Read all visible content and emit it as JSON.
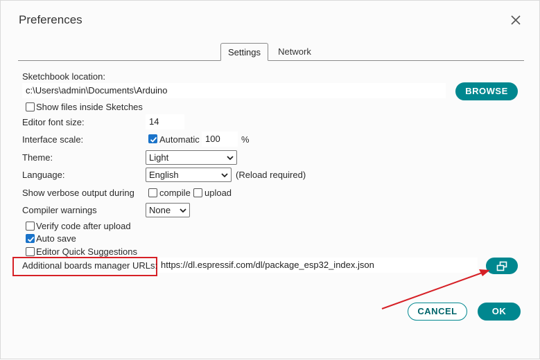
{
  "dialog": {
    "title": "Preferences"
  },
  "tabs": [
    {
      "label": "Settings"
    },
    {
      "label": "Network"
    }
  ],
  "settings": {
    "sketchbook_label": "Sketchbook location:",
    "sketchbook_path": "c:\\Users\\admin\\Documents\\Arduino",
    "browse_label": "BROWSE",
    "show_files_label": "Show files inside Sketches",
    "show_files_checked": false,
    "font_size_label": "Editor font size:",
    "font_size_value": "14",
    "interface_scale_label": "Interface scale:",
    "automatic_label": "Automatic",
    "automatic_checked": true,
    "scale_value": "100",
    "scale_unit": "%",
    "theme_label": "Theme:",
    "theme_value": "Light",
    "language_label": "Language:",
    "language_value": "English",
    "reload_note": "(Reload required)",
    "verbose_label": "Show verbose output during",
    "compile_label": "compile",
    "compile_checked": false,
    "upload_label": "upload",
    "upload_checked": false,
    "compiler_warnings_label": "Compiler warnings",
    "compiler_warnings_value": "None",
    "verify_label": "Verify code after upload",
    "verify_checked": false,
    "autosave_label": "Auto save",
    "autosave_checked": true,
    "quick_suggestions_label": "Editor Quick Suggestions",
    "quick_suggestions_checked": false,
    "boards_url_label": "Additional boards manager URLs:",
    "boards_url_value": "https://dl.espressif.com/dl/package_esp32_index.json"
  },
  "footer": {
    "cancel_label": "CANCEL",
    "ok_label": "OK"
  },
  "colors": {
    "accent": "#00878f",
    "annotation": "#d62026",
    "checkbox": "#1a73c9"
  },
  "icons": [
    "close-icon",
    "open-window-icon",
    "chevron-down-icon",
    "checkmark-icon"
  ]
}
